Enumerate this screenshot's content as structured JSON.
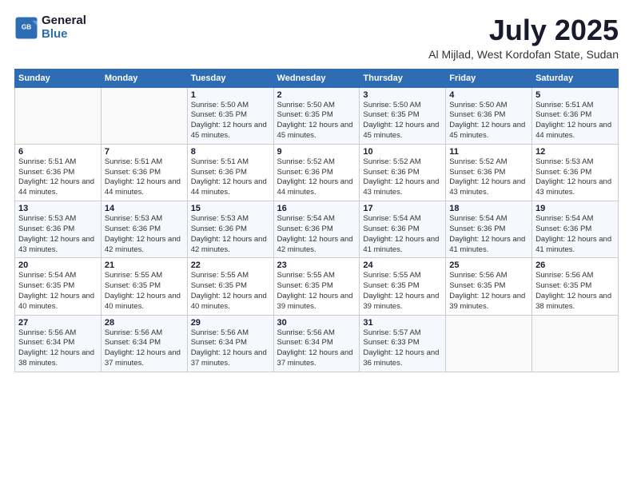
{
  "header": {
    "logo_line1": "General",
    "logo_line2": "Blue",
    "title": "July 2025",
    "subtitle": "Al Mijlad, West Kordofan State, Sudan"
  },
  "days_of_week": [
    "Sunday",
    "Monday",
    "Tuesday",
    "Wednesday",
    "Thursday",
    "Friday",
    "Saturday"
  ],
  "weeks": [
    [
      {
        "day": "",
        "info": ""
      },
      {
        "day": "",
        "info": ""
      },
      {
        "day": "1",
        "info": "Sunrise: 5:50 AM\nSunset: 6:35 PM\nDaylight: 12 hours and 45 minutes."
      },
      {
        "day": "2",
        "info": "Sunrise: 5:50 AM\nSunset: 6:35 PM\nDaylight: 12 hours and 45 minutes."
      },
      {
        "day": "3",
        "info": "Sunrise: 5:50 AM\nSunset: 6:35 PM\nDaylight: 12 hours and 45 minutes."
      },
      {
        "day": "4",
        "info": "Sunrise: 5:50 AM\nSunset: 6:36 PM\nDaylight: 12 hours and 45 minutes."
      },
      {
        "day": "5",
        "info": "Sunrise: 5:51 AM\nSunset: 6:36 PM\nDaylight: 12 hours and 44 minutes."
      }
    ],
    [
      {
        "day": "6",
        "info": "Sunrise: 5:51 AM\nSunset: 6:36 PM\nDaylight: 12 hours and 44 minutes."
      },
      {
        "day": "7",
        "info": "Sunrise: 5:51 AM\nSunset: 6:36 PM\nDaylight: 12 hours and 44 minutes."
      },
      {
        "day": "8",
        "info": "Sunrise: 5:51 AM\nSunset: 6:36 PM\nDaylight: 12 hours and 44 minutes."
      },
      {
        "day": "9",
        "info": "Sunrise: 5:52 AM\nSunset: 6:36 PM\nDaylight: 12 hours and 44 minutes."
      },
      {
        "day": "10",
        "info": "Sunrise: 5:52 AM\nSunset: 6:36 PM\nDaylight: 12 hours and 43 minutes."
      },
      {
        "day": "11",
        "info": "Sunrise: 5:52 AM\nSunset: 6:36 PM\nDaylight: 12 hours and 43 minutes."
      },
      {
        "day": "12",
        "info": "Sunrise: 5:53 AM\nSunset: 6:36 PM\nDaylight: 12 hours and 43 minutes."
      }
    ],
    [
      {
        "day": "13",
        "info": "Sunrise: 5:53 AM\nSunset: 6:36 PM\nDaylight: 12 hours and 43 minutes."
      },
      {
        "day": "14",
        "info": "Sunrise: 5:53 AM\nSunset: 6:36 PM\nDaylight: 12 hours and 42 minutes."
      },
      {
        "day": "15",
        "info": "Sunrise: 5:53 AM\nSunset: 6:36 PM\nDaylight: 12 hours and 42 minutes."
      },
      {
        "day": "16",
        "info": "Sunrise: 5:54 AM\nSunset: 6:36 PM\nDaylight: 12 hours and 42 minutes."
      },
      {
        "day": "17",
        "info": "Sunrise: 5:54 AM\nSunset: 6:36 PM\nDaylight: 12 hours and 41 minutes."
      },
      {
        "day": "18",
        "info": "Sunrise: 5:54 AM\nSunset: 6:36 PM\nDaylight: 12 hours and 41 minutes."
      },
      {
        "day": "19",
        "info": "Sunrise: 5:54 AM\nSunset: 6:36 PM\nDaylight: 12 hours and 41 minutes."
      }
    ],
    [
      {
        "day": "20",
        "info": "Sunrise: 5:54 AM\nSunset: 6:35 PM\nDaylight: 12 hours and 40 minutes."
      },
      {
        "day": "21",
        "info": "Sunrise: 5:55 AM\nSunset: 6:35 PM\nDaylight: 12 hours and 40 minutes."
      },
      {
        "day": "22",
        "info": "Sunrise: 5:55 AM\nSunset: 6:35 PM\nDaylight: 12 hours and 40 minutes."
      },
      {
        "day": "23",
        "info": "Sunrise: 5:55 AM\nSunset: 6:35 PM\nDaylight: 12 hours and 39 minutes."
      },
      {
        "day": "24",
        "info": "Sunrise: 5:55 AM\nSunset: 6:35 PM\nDaylight: 12 hours and 39 minutes."
      },
      {
        "day": "25",
        "info": "Sunrise: 5:56 AM\nSunset: 6:35 PM\nDaylight: 12 hours and 39 minutes."
      },
      {
        "day": "26",
        "info": "Sunrise: 5:56 AM\nSunset: 6:35 PM\nDaylight: 12 hours and 38 minutes."
      }
    ],
    [
      {
        "day": "27",
        "info": "Sunrise: 5:56 AM\nSunset: 6:34 PM\nDaylight: 12 hours and 38 minutes."
      },
      {
        "day": "28",
        "info": "Sunrise: 5:56 AM\nSunset: 6:34 PM\nDaylight: 12 hours and 37 minutes."
      },
      {
        "day": "29",
        "info": "Sunrise: 5:56 AM\nSunset: 6:34 PM\nDaylight: 12 hours and 37 minutes."
      },
      {
        "day": "30",
        "info": "Sunrise: 5:56 AM\nSunset: 6:34 PM\nDaylight: 12 hours and 37 minutes."
      },
      {
        "day": "31",
        "info": "Sunrise: 5:57 AM\nSunset: 6:33 PM\nDaylight: 12 hours and 36 minutes."
      },
      {
        "day": "",
        "info": ""
      },
      {
        "day": "",
        "info": ""
      }
    ]
  ]
}
